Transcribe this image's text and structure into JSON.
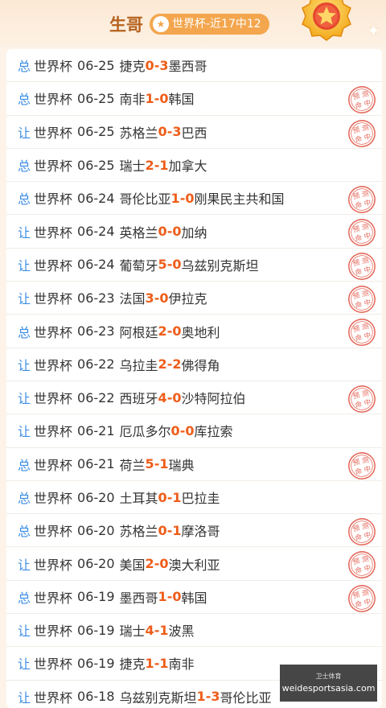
{
  "header": {
    "expert_name": "生哥",
    "record_label": "世界杯-近17中12",
    "star_icon": "star-icon",
    "medal_icon": "star-medal-icon"
  },
  "colors": {
    "bet_type": "#3b8de3",
    "score": "#ee5d19",
    "stamp": "#e4685a",
    "pill": "#f3a64d"
  },
  "stamp_text": [
    "预",
    "测",
    "命",
    "中"
  ],
  "matches": [
    {
      "type": "总",
      "league": "世界杯",
      "date": "06-25",
      "home": "捷克",
      "home_score": "0",
      "away_score": "3",
      "away": "墨西哥",
      "hit": false
    },
    {
      "type": "总",
      "league": "世界杯",
      "date": "06-25",
      "home": "南非",
      "home_score": "1",
      "away_score": "0",
      "away": "韩国",
      "hit": true
    },
    {
      "type": "让",
      "league": "世界杯",
      "date": "06-25",
      "home": "苏格兰",
      "home_score": "0",
      "away_score": "3",
      "away": "巴西",
      "hit": true
    },
    {
      "type": "总",
      "league": "世界杯",
      "date": "06-25",
      "home": "瑞士",
      "home_score": "2",
      "away_score": "1",
      "away": "加拿大",
      "hit": false
    },
    {
      "type": "总",
      "league": "世界杯",
      "date": "06-24",
      "home": "哥伦比亚",
      "home_score": "1",
      "away_score": "0",
      "away": "刚果民主共和国",
      "hit": true
    },
    {
      "type": "让",
      "league": "世界杯",
      "date": "06-24",
      "home": "英格兰",
      "home_score": "0",
      "away_score": "0",
      "away": "加纳",
      "hit": true
    },
    {
      "type": "让",
      "league": "世界杯",
      "date": "06-24",
      "home": "葡萄牙",
      "home_score": "5",
      "away_score": "0",
      "away": "乌兹别克斯坦",
      "hit": true
    },
    {
      "type": "让",
      "league": "世界杯",
      "date": "06-23",
      "home": "法国",
      "home_score": "3",
      "away_score": "0",
      "away": "伊拉克",
      "hit": true
    },
    {
      "type": "总",
      "league": "世界杯",
      "date": "06-23",
      "home": "阿根廷",
      "home_score": "2",
      "away_score": "0",
      "away": "奥地利",
      "hit": true
    },
    {
      "type": "让",
      "league": "世界杯",
      "date": "06-22",
      "home": "乌拉圭",
      "home_score": "2",
      "away_score": "2",
      "away": "佛得角",
      "hit": false
    },
    {
      "type": "让",
      "league": "世界杯",
      "date": "06-22",
      "home": "西班牙",
      "home_score": "4",
      "away_score": "0",
      "away": "沙特阿拉伯",
      "hit": true
    },
    {
      "type": "让",
      "league": "世界杯",
      "date": "06-21",
      "home": "厄瓜多尔",
      "home_score": "0",
      "away_score": "0",
      "away": "库拉索",
      "hit": false
    },
    {
      "type": "总",
      "league": "世界杯",
      "date": "06-21",
      "home": "荷兰",
      "home_score": "5",
      "away_score": "1",
      "away": "瑞典",
      "hit": true
    },
    {
      "type": "总",
      "league": "世界杯",
      "date": "06-20",
      "home": "土耳其",
      "home_score": "0",
      "away_score": "1",
      "away": "巴拉圭",
      "hit": false
    },
    {
      "type": "总",
      "league": "世界杯",
      "date": "06-20",
      "home": "苏格兰",
      "home_score": "0",
      "away_score": "1",
      "away": "摩洛哥",
      "hit": true
    },
    {
      "type": "让",
      "league": "世界杯",
      "date": "06-20",
      "home": "美国",
      "home_score": "2",
      "away_score": "0",
      "away": "澳大利亚",
      "hit": true
    },
    {
      "type": "总",
      "league": "世界杯",
      "date": "06-19",
      "home": "墨西哥",
      "home_score": "1",
      "away_score": "0",
      "away": "韩国",
      "hit": true
    },
    {
      "type": "让",
      "league": "世界杯",
      "date": "06-19",
      "home": "瑞士",
      "home_score": "4",
      "away_score": "1",
      "away": "波黑",
      "hit": false
    },
    {
      "type": "让",
      "league": "世界杯",
      "date": "06-19",
      "home": "捷克",
      "home_score": "1",
      "away_score": "1",
      "away": "南非",
      "hit": false
    },
    {
      "type": "让",
      "league": "世界杯",
      "date": "06-18",
      "home": "乌兹别克斯坦",
      "home_score": "1",
      "away_score": "3",
      "away": "哥伦比亚",
      "hit": false
    }
  ],
  "watermark": {
    "top": "卫士体育",
    "site": "weidesportsasia.com"
  }
}
